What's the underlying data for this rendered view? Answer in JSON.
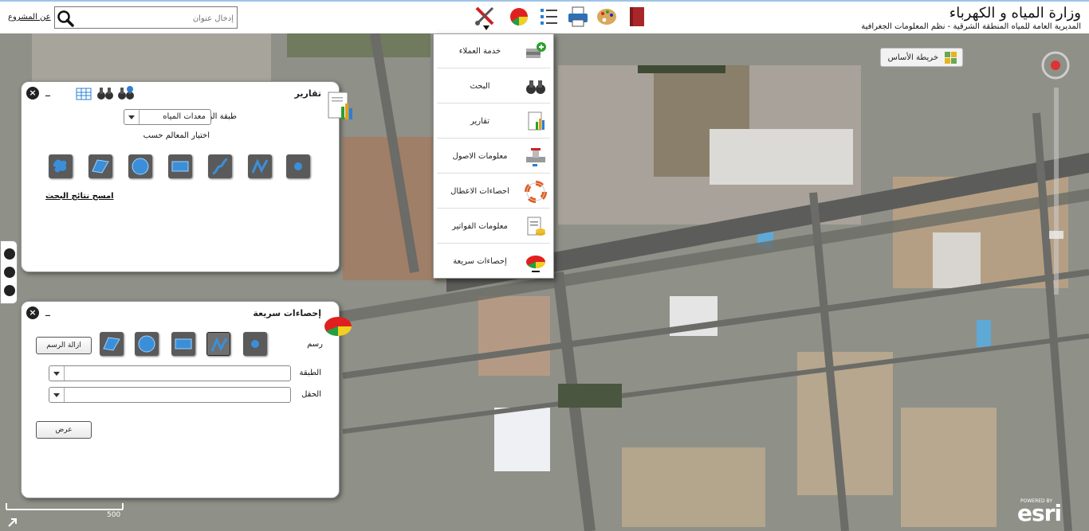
{
  "header": {
    "title": "وزارة المياه و الكهرباء",
    "subtitle": "المديرية العامة للمياه المنطقة الشرقية - نظم المعلومات الجغرافية",
    "search_placeholder": "إدخال عنوان",
    "about_label": "عن المشروع"
  },
  "toolbar": {
    "icons": [
      "tools-icon",
      "pie-chart-icon",
      "list-icon",
      "printer-icon",
      "palette-icon",
      "book-icon"
    ]
  },
  "menu": {
    "items": [
      {
        "label": "خدمة العملاء",
        "icon": "customer-service-icon"
      },
      {
        "label": "البحث",
        "icon": "binoculars-icon"
      },
      {
        "label": "تقارير",
        "icon": "report-icon"
      },
      {
        "label": "معلومات الاصول",
        "icon": "valve-icon"
      },
      {
        "label": "احصاءات الاعطال",
        "icon": "lifebuoy-icon"
      },
      {
        "label": "معلومات الفواتير",
        "icon": "invoice-icon"
      },
      {
        "label": "إحصاءات سريعة",
        "icon": "pie-chart-icon"
      }
    ]
  },
  "reports_panel": {
    "title": "تقارير",
    "search_layer_label": "طبقة البحث",
    "search_layer_value": "معدات المياه",
    "select_features_label": "اختيار المعالم حسب",
    "clear_results_label": "امسح نتائج البحث",
    "shape_tools": [
      "point",
      "polyline",
      "freehand-line",
      "rectangle",
      "circle",
      "polygon",
      "freehand-polygon"
    ]
  },
  "quick_stats_panel": {
    "title": "إحصاءات سريعة",
    "draw_label": "رسم",
    "clear_drawing_label": "ازالة الرسم",
    "layer_label": "الطبقة",
    "field_label": "الحقل",
    "layer_value": "",
    "field_value": "",
    "display_label": "عرض",
    "shape_tools": [
      "point",
      "polyline",
      "rectangle",
      "circle",
      "polygon"
    ],
    "selected_tool": "polyline"
  },
  "basemap": {
    "label": "خريطة الأساس"
  },
  "map": {
    "scale_label": "500"
  },
  "branding": {
    "esri_label": "esri",
    "powered_by": "POWERED BY"
  },
  "colors": {
    "accent": "#9ec3e6",
    "tool_bg": "#5a5a5a",
    "tool_glyph": "#3b8fd9"
  }
}
